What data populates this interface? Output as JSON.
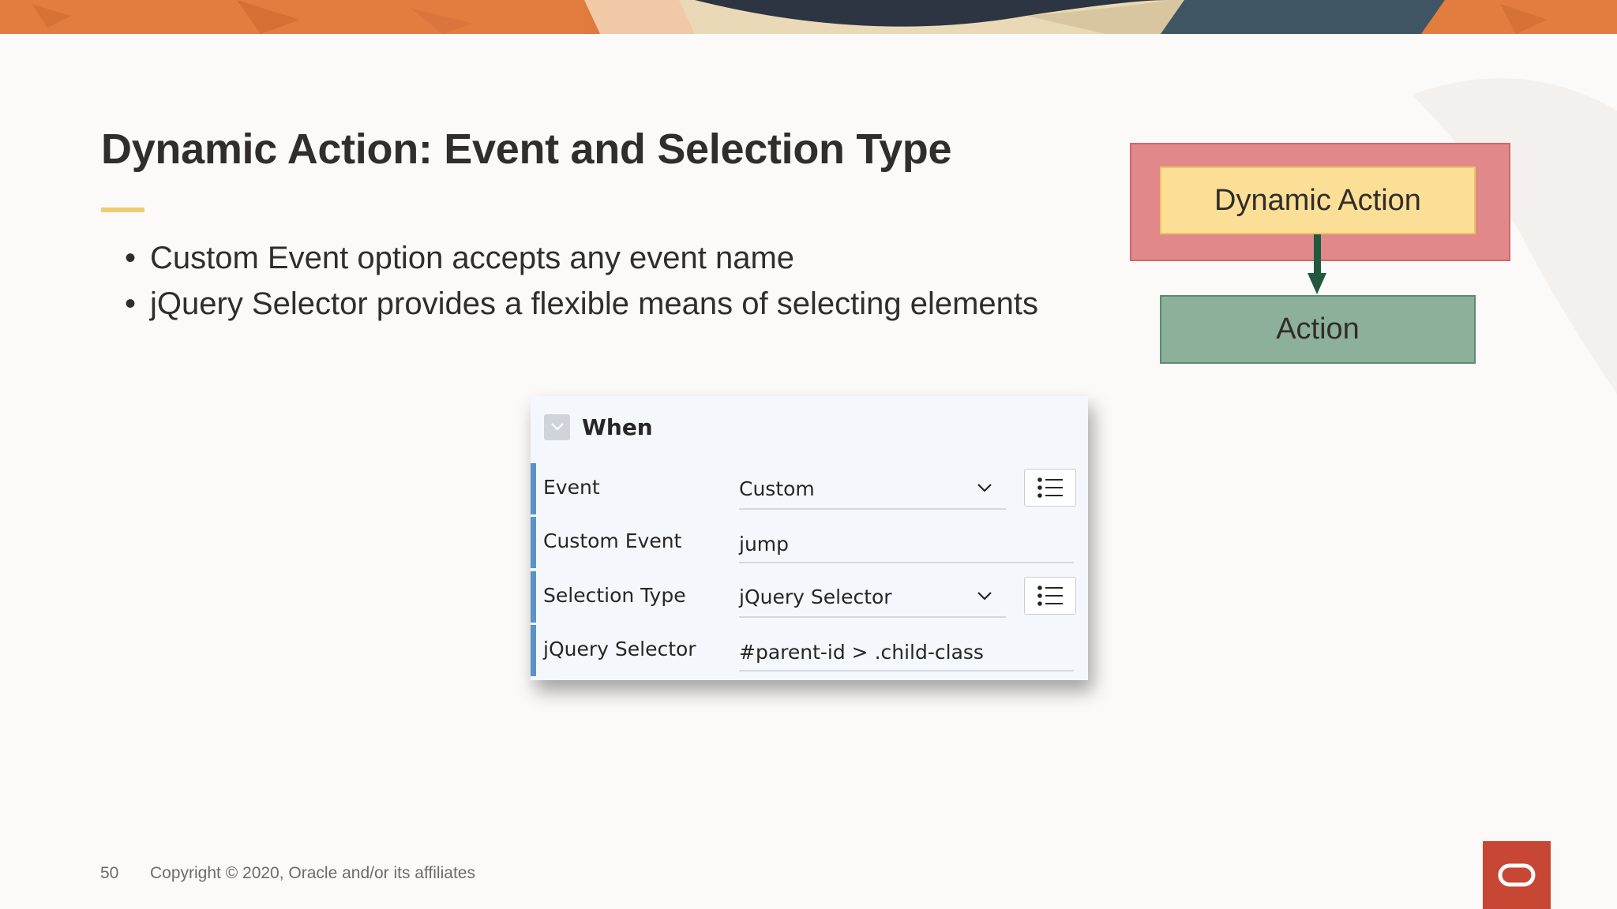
{
  "slide": {
    "title": "Dynamic Action: Event and Selection Type",
    "bullets": [
      "Custom Event option accepts any event name",
      "jQuery Selector provides a flexible means of selecting elements"
    ],
    "bullet_glyph": "•"
  },
  "diagram": {
    "outer_label": "Dynamic Action",
    "child_label": "Action"
  },
  "panel": {
    "header": "When",
    "rows": [
      {
        "label": "Event",
        "value": "Custom",
        "control": "select"
      },
      {
        "label": "Custom Event",
        "value": "jump",
        "control": "text"
      },
      {
        "label": "Selection Type",
        "value": "jQuery Selector",
        "control": "select"
      },
      {
        "label": "jQuery Selector",
        "value": "#parent-id > .child-class",
        "control": "text"
      }
    ]
  },
  "footer": {
    "page_number": "50",
    "copyright": "Copyright © 2020, Oracle and/or its affiliates"
  },
  "colors": {
    "accent_rule": "#f0cc71",
    "row_bar": "#5a93c8",
    "oracle_red": "#c74634",
    "diagram_outer": "#e0888a",
    "diagram_inner": "#fbdf96",
    "diagram_action": "#8db09b",
    "arrow": "#1f5a3f"
  },
  "icons": {
    "collapse": "chevron-down-icon",
    "select_caret": "chevron-down-icon",
    "list_button": "list-icon",
    "logo": "oracle-logo-icon"
  }
}
